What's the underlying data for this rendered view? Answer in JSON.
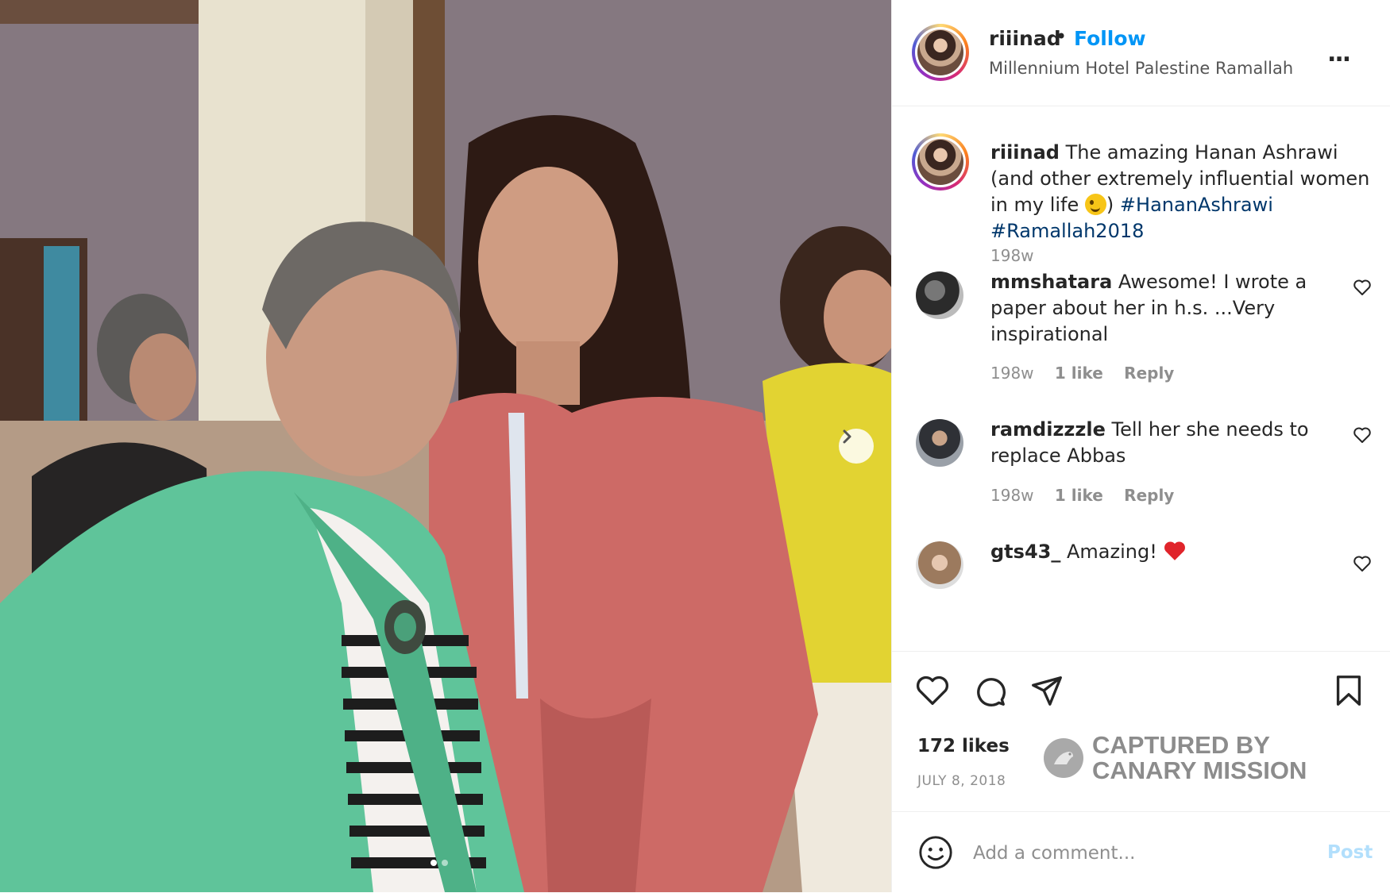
{
  "post": {
    "username": "riiinad",
    "separator": "•",
    "follow_label": "Follow",
    "location": "Millennium Hotel Palestine Ramallah",
    "more_label": "...",
    "caption": {
      "username": "riiinad",
      "text_before": "The amazing Hanan Ashrawi (and other extremely influential women in my life ",
      "text_after": ")",
      "hashtags": [
        "#HananAshrawi",
        "#Ramallah2018"
      ],
      "time": "198w"
    },
    "comments": [
      {
        "username": "mmshatara",
        "text": "Awesome! I wrote a paper about her in h.s. ...Very inspirational",
        "time": "198w",
        "likes": "1 like",
        "reply": "Reply"
      },
      {
        "username": "ramdizzzle",
        "text": "Tell her she needs to replace Abbas",
        "time": "198w",
        "likes": "1 like",
        "reply": "Reply"
      },
      {
        "username": "gts43_",
        "text": "Amazing!",
        "time": "",
        "likes": "",
        "reply": ""
      }
    ],
    "likes": "172 likes",
    "date": "JULY 8, 2018",
    "add_comment_placeholder": "Add a comment...",
    "post_label": "Post"
  },
  "watermark": {
    "line1": "CAPTURED BY",
    "line2": "CANARY MISSION"
  },
  "carousel": {
    "current": 1,
    "total": 2
  },
  "colors": {
    "link": "#0095f6",
    "hashtag": "#00376b",
    "muted": "#8e8e8e",
    "like_red": "#ed4956"
  },
  "icons": [
    "heart-icon",
    "comment-icon",
    "share-icon",
    "bookmark-icon",
    "emoji-icon",
    "next-arrow-icon",
    "more-icon"
  ]
}
